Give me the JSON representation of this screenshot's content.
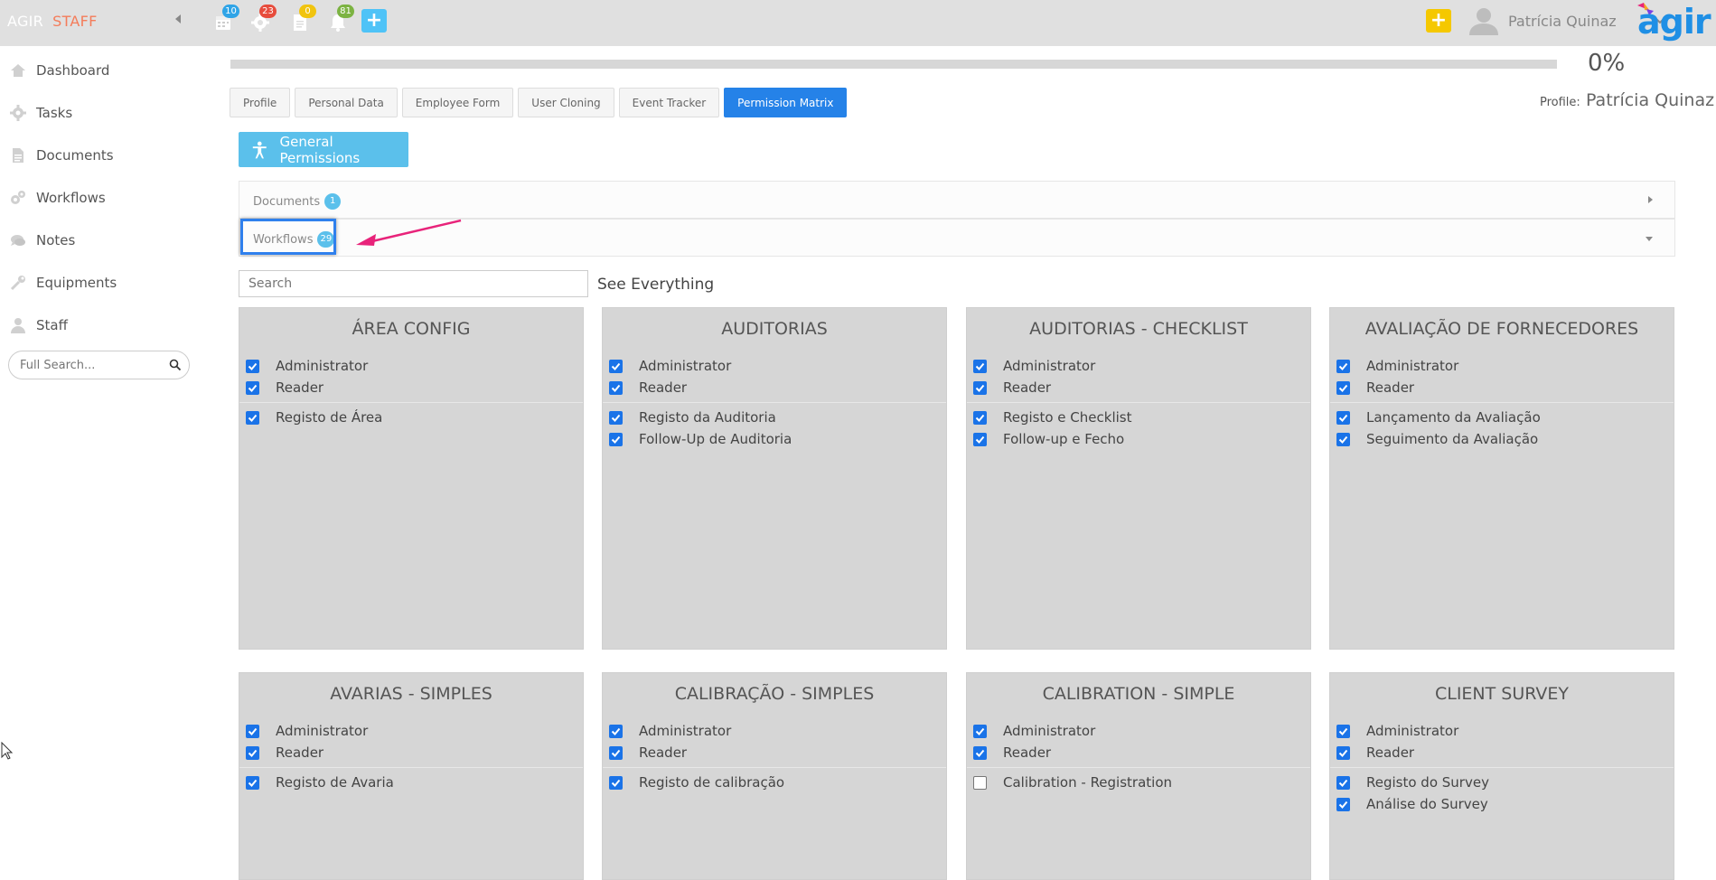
{
  "topbar": {
    "brand_left": "AGIR",
    "brand_right": "STAFF",
    "badges": [
      {
        "icon": "calendar-icon",
        "count": "10",
        "color": "blue"
      },
      {
        "icon": "gear-icon",
        "count": "23",
        "color": "red"
      },
      {
        "icon": "document-icon",
        "count": "0",
        "color": "yellow"
      },
      {
        "icon": "bell-icon",
        "count": "81",
        "color": "green"
      }
    ],
    "plus_label": "+",
    "user_name": "Patrícia Quinaz",
    "logo_text": "agir"
  },
  "sidebar": {
    "items": [
      {
        "label": "Dashboard",
        "icon": "home-icon"
      },
      {
        "label": "Tasks",
        "icon": "gear-icon"
      },
      {
        "label": "Documents",
        "icon": "document-icon"
      },
      {
        "label": "Workflows",
        "icon": "gears-icon"
      },
      {
        "label": "Notes",
        "icon": "chat-icon"
      },
      {
        "label": "Equipments",
        "icon": "wrench-icon"
      },
      {
        "label": "Staff",
        "icon": "user-icon"
      }
    ],
    "search_placeholder": "Full Search..."
  },
  "progress": {
    "value": 0,
    "label": "0%"
  },
  "profile": {
    "label": "Profile:",
    "name": "Patrícia Quinaz"
  },
  "tabs": [
    {
      "label": "Profile",
      "active": false
    },
    {
      "label": "Personal Data",
      "active": false
    },
    {
      "label": "Employee Form",
      "active": false
    },
    {
      "label": "User Cloning",
      "active": false
    },
    {
      "label": "Event Tracker",
      "active": false
    },
    {
      "label": "Permission Matrix",
      "active": true
    }
  ],
  "general_permissions_label": "General Permissions",
  "accordion": [
    {
      "title": "Documents",
      "count": "1",
      "expanded": false
    },
    {
      "title": "Workflows",
      "count": "29",
      "expanded": true
    }
  ],
  "search": {
    "placeholder": "Search"
  },
  "see_everything": "See Everything",
  "cards": [
    {
      "title": "ÁREA CONFIG",
      "roles": [
        {
          "label": "Administrator",
          "checked": true
        },
        {
          "label": "Reader",
          "checked": true
        }
      ],
      "steps": [
        {
          "label": "Registo de Área",
          "checked": true
        }
      ]
    },
    {
      "title": "AUDITORIAS",
      "roles": [
        {
          "label": "Administrator",
          "checked": true
        },
        {
          "label": "Reader",
          "checked": true
        }
      ],
      "steps": [
        {
          "label": "Registo da Auditoria",
          "checked": true
        },
        {
          "label": "Follow-Up de Auditoria",
          "checked": true
        }
      ]
    },
    {
      "title": "AUDITORIAS - CHECKLIST",
      "roles": [
        {
          "label": "Administrator",
          "checked": true
        },
        {
          "label": "Reader",
          "checked": true
        }
      ],
      "steps": [
        {
          "label": "Registo e Checklist",
          "checked": true
        },
        {
          "label": "Follow-up e Fecho",
          "checked": true
        }
      ]
    },
    {
      "title": "AVALIAÇÃO DE FORNECEDORES",
      "roles": [
        {
          "label": "Administrator",
          "checked": true
        },
        {
          "label": "Reader",
          "checked": true
        }
      ],
      "steps": [
        {
          "label": "Lançamento da Avaliação",
          "checked": true
        },
        {
          "label": "Seguimento da Avaliação",
          "checked": true
        }
      ]
    },
    {
      "title": "AVARIAS - SIMPLES",
      "roles": [
        {
          "label": "Administrator",
          "checked": true
        },
        {
          "label": "Reader",
          "checked": true
        }
      ],
      "steps": [
        {
          "label": "Registo de Avaria",
          "checked": true
        }
      ]
    },
    {
      "title": "CALIBRAÇÃO - SIMPLES",
      "roles": [
        {
          "label": "Administrator",
          "checked": true
        },
        {
          "label": "Reader",
          "checked": true
        }
      ],
      "steps": [
        {
          "label": "Registo de calibração",
          "checked": true
        }
      ]
    },
    {
      "title": "CALIBRATION - SIMPLE",
      "roles": [
        {
          "label": "Administrator",
          "checked": true
        },
        {
          "label": "Reader",
          "checked": true
        }
      ],
      "steps": [
        {
          "label": "Calibration - Registration",
          "checked": false
        }
      ]
    },
    {
      "title": "CLIENT SURVEY",
      "roles": [
        {
          "label": "Administrator",
          "checked": true
        },
        {
          "label": "Reader",
          "checked": true
        }
      ],
      "steps": [
        {
          "label": "Registo do Survey",
          "checked": true
        },
        {
          "label": "Análise do Survey",
          "checked": true
        }
      ]
    }
  ],
  "colors": {
    "accent": "#2582e8",
    "checkbox": "#1a73e8",
    "card_bg": "#d6d6d6",
    "general_btn": "#5bc0eb",
    "annotation": "#e8237a",
    "highlight": "#2f80ed"
  }
}
